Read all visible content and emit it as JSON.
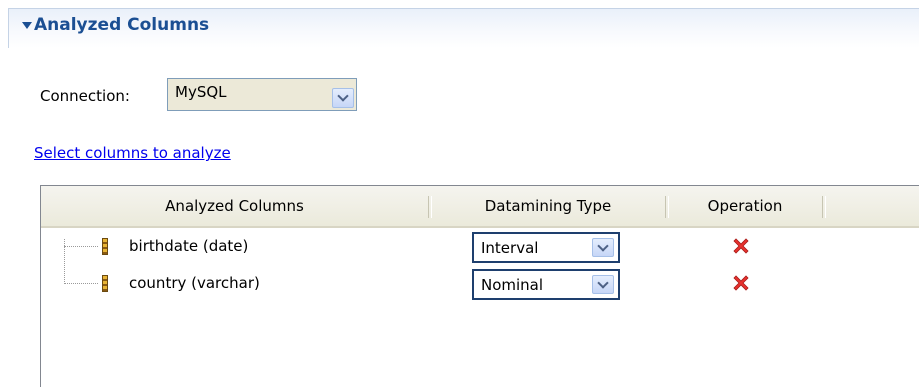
{
  "section": {
    "title": "Analyzed Columns"
  },
  "connection": {
    "label": "Connection:",
    "value": "MySQL"
  },
  "link": {
    "label": "Select columns to analyze"
  },
  "table": {
    "headers": [
      "Analyzed Columns",
      "Datamining Type",
      "Operation"
    ],
    "rows": [
      {
        "column": "birthdate (date)",
        "type": "Interval",
        "operation_icon": "delete-icon"
      },
      {
        "column": "country (varchar)",
        "type": "Nominal",
        "operation_icon": "delete-icon"
      }
    ]
  },
  "colors": {
    "section_title": "#1b4f93",
    "link": "#0000ee",
    "delete": "#e8322f"
  }
}
